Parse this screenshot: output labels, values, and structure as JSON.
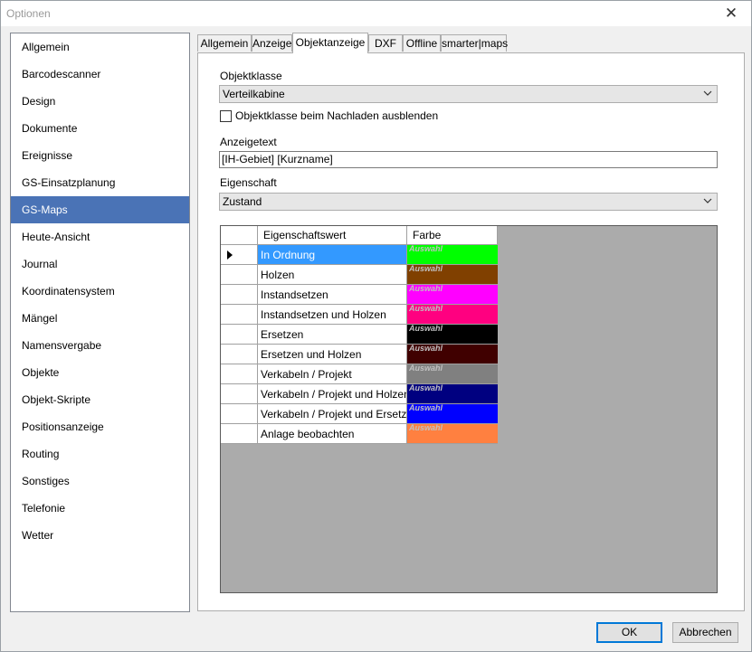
{
  "window": {
    "title": "Optionen"
  },
  "sidebar": {
    "items": [
      {
        "label": "Allgemein"
      },
      {
        "label": "Barcodescanner"
      },
      {
        "label": "Design"
      },
      {
        "label": "Dokumente"
      },
      {
        "label": "Ereignisse"
      },
      {
        "label": "GS-Einsatzplanung"
      },
      {
        "label": "GS-Maps"
      },
      {
        "label": "Heute-Ansicht"
      },
      {
        "label": "Journal"
      },
      {
        "label": "Koordinatensystem"
      },
      {
        "label": "Mängel"
      },
      {
        "label": "Namensvergabe"
      },
      {
        "label": "Objekte"
      },
      {
        "label": "Objekt-Skripte"
      },
      {
        "label": "Positionsanzeige"
      },
      {
        "label": "Routing"
      },
      {
        "label": "Sonstiges"
      },
      {
        "label": "Telefonie"
      },
      {
        "label": "Wetter"
      }
    ],
    "selected": "GS-Maps"
  },
  "tabs": [
    {
      "label": "Allgemein"
    },
    {
      "label": "Anzeige"
    },
    {
      "label": "Objektanzeige"
    },
    {
      "label": "DXF"
    },
    {
      "label": "Offline"
    },
    {
      "label": "smarter|maps"
    }
  ],
  "form": {
    "objektklasse_label": "Objektklasse",
    "objektklasse_value": "Verteilkabine",
    "hide_checkbox_label": "Objektklasse beim Nachladen ausblenden",
    "hide_checked": false,
    "anzeigetext_label": "Anzeigetext",
    "anzeigetext_value": "[IH-Gebiet] [Kurzname]",
    "eigenschaft_label": "Eigenschaft",
    "eigenschaft_value": "Zustand"
  },
  "grid": {
    "col_value": "Eigenschaftswert",
    "col_color": "Farbe",
    "color_text": "Auswahl",
    "rows": [
      {
        "value": "In Ordnung",
        "color": "#00ff00",
        "selected": true
      },
      {
        "value": "Holzen",
        "color": "#804000"
      },
      {
        "value": "Instandsetzen",
        "color": "#ff00ff"
      },
      {
        "value": "Instandsetzen und Holzen",
        "color": "#ff0080"
      },
      {
        "value": "Ersetzen",
        "color": "#000000"
      },
      {
        "value": "Ersetzen und Holzen",
        "color": "#400000"
      },
      {
        "value": "Verkabeln / Projekt",
        "color": "#808080"
      },
      {
        "value": "Verkabeln / Projekt und Holzen",
        "color": "#000080"
      },
      {
        "value": "Verkabeln / Projekt und Ersetzen",
        "color": "#0000ff"
      },
      {
        "value": "Anlage beobachten",
        "color": "#ff8040"
      }
    ]
  },
  "buttons": {
    "ok": "OK",
    "cancel": "Abbrechen"
  }
}
